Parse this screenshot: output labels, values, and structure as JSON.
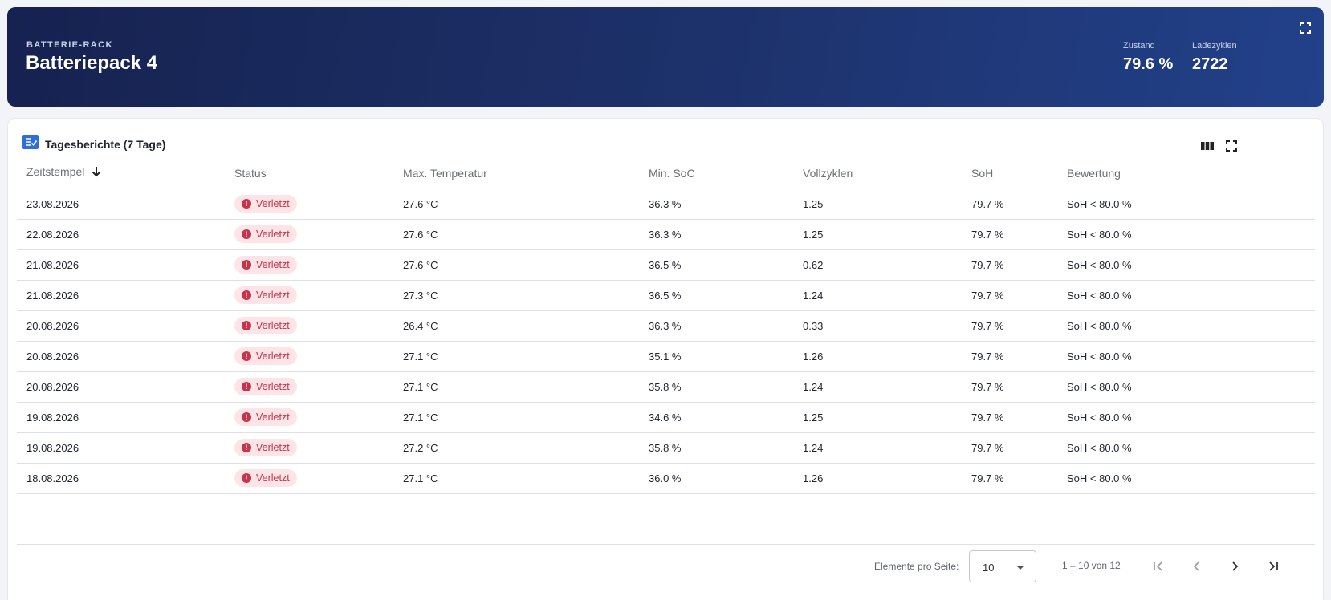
{
  "header": {
    "kicker": "BATTERIE-RACK",
    "title": "Batteriepack 4",
    "stats": [
      {
        "label": "Zustand",
        "value": "79.6 %"
      },
      {
        "label": "Ladezyklen",
        "value": "2722"
      }
    ]
  },
  "card": {
    "title": "Tagesberichte (7 Tage)"
  },
  "table": {
    "columns": [
      "Zeitstempel",
      "Status",
      "Max. Temperatur",
      "Min. SoC",
      "Vollzyklen",
      "SoH",
      "Bewertung"
    ],
    "rows": [
      [
        "23.08.2026",
        "Verletzt",
        "27.6 °C",
        "36.3 %",
        "1.25",
        "79.7 %",
        "SoH < 80.0 %"
      ],
      [
        "22.08.2026",
        "Verletzt",
        "27.6 °C",
        "36.3 %",
        "1.25",
        "79.7 %",
        "SoH < 80.0 %"
      ],
      [
        "21.08.2026",
        "Verletzt",
        "27.6 °C",
        "36.5 %",
        "0.62",
        "79.7 %",
        "SoH < 80.0 %"
      ],
      [
        "21.08.2026",
        "Verletzt",
        "27.3 °C",
        "36.5 %",
        "1.24",
        "79.7 %",
        "SoH < 80.0 %"
      ],
      [
        "20.08.2026",
        "Verletzt",
        "26.4 °C",
        "36.3 %",
        "0.33",
        "79.7 %",
        "SoH < 80.0 %"
      ],
      [
        "20.08.2026",
        "Verletzt",
        "27.1 °C",
        "35.1 %",
        "1.26",
        "79.7 %",
        "SoH < 80.0 %"
      ],
      [
        "20.08.2026",
        "Verletzt",
        "27.1 °C",
        "35.8 %",
        "1.24",
        "79.7 %",
        "SoH < 80.0 %"
      ],
      [
        "19.08.2026",
        "Verletzt",
        "27.1 °C",
        "34.6 %",
        "1.25",
        "79.7 %",
        "SoH < 80.0 %"
      ],
      [
        "19.08.2026",
        "Verletzt",
        "27.2 °C",
        "35.8 %",
        "1.24",
        "79.7 %",
        "SoH < 80.0 %"
      ],
      [
        "18.08.2026",
        "Verletzt",
        "27.1 °C",
        "36.0 %",
        "1.26",
        "79.7 %",
        "SoH < 80.0 %"
      ]
    ]
  },
  "pager": {
    "items_label": "Elemente pro Seite:",
    "page_size": "10",
    "range": "1 – 10 von 12"
  },
  "colors": {
    "hero_start": "#162250",
    "hero_end": "#22418a",
    "badge_bg": "#fde4e7",
    "badge_text": "#c8324a",
    "accent": "#2f6fdb"
  },
  "icons": {
    "hero_fullscreen": "fullscreen-icon",
    "card_title": "checklist-icon",
    "columns_toggle": "view-columns-icon",
    "card_fullscreen": "fullscreen-icon",
    "sort": "arrow-down-icon",
    "status": "error-icon",
    "first": "first-page-icon",
    "prev": "chevron-left-icon",
    "next": "chevron-right-icon",
    "last": "last-page-icon"
  }
}
